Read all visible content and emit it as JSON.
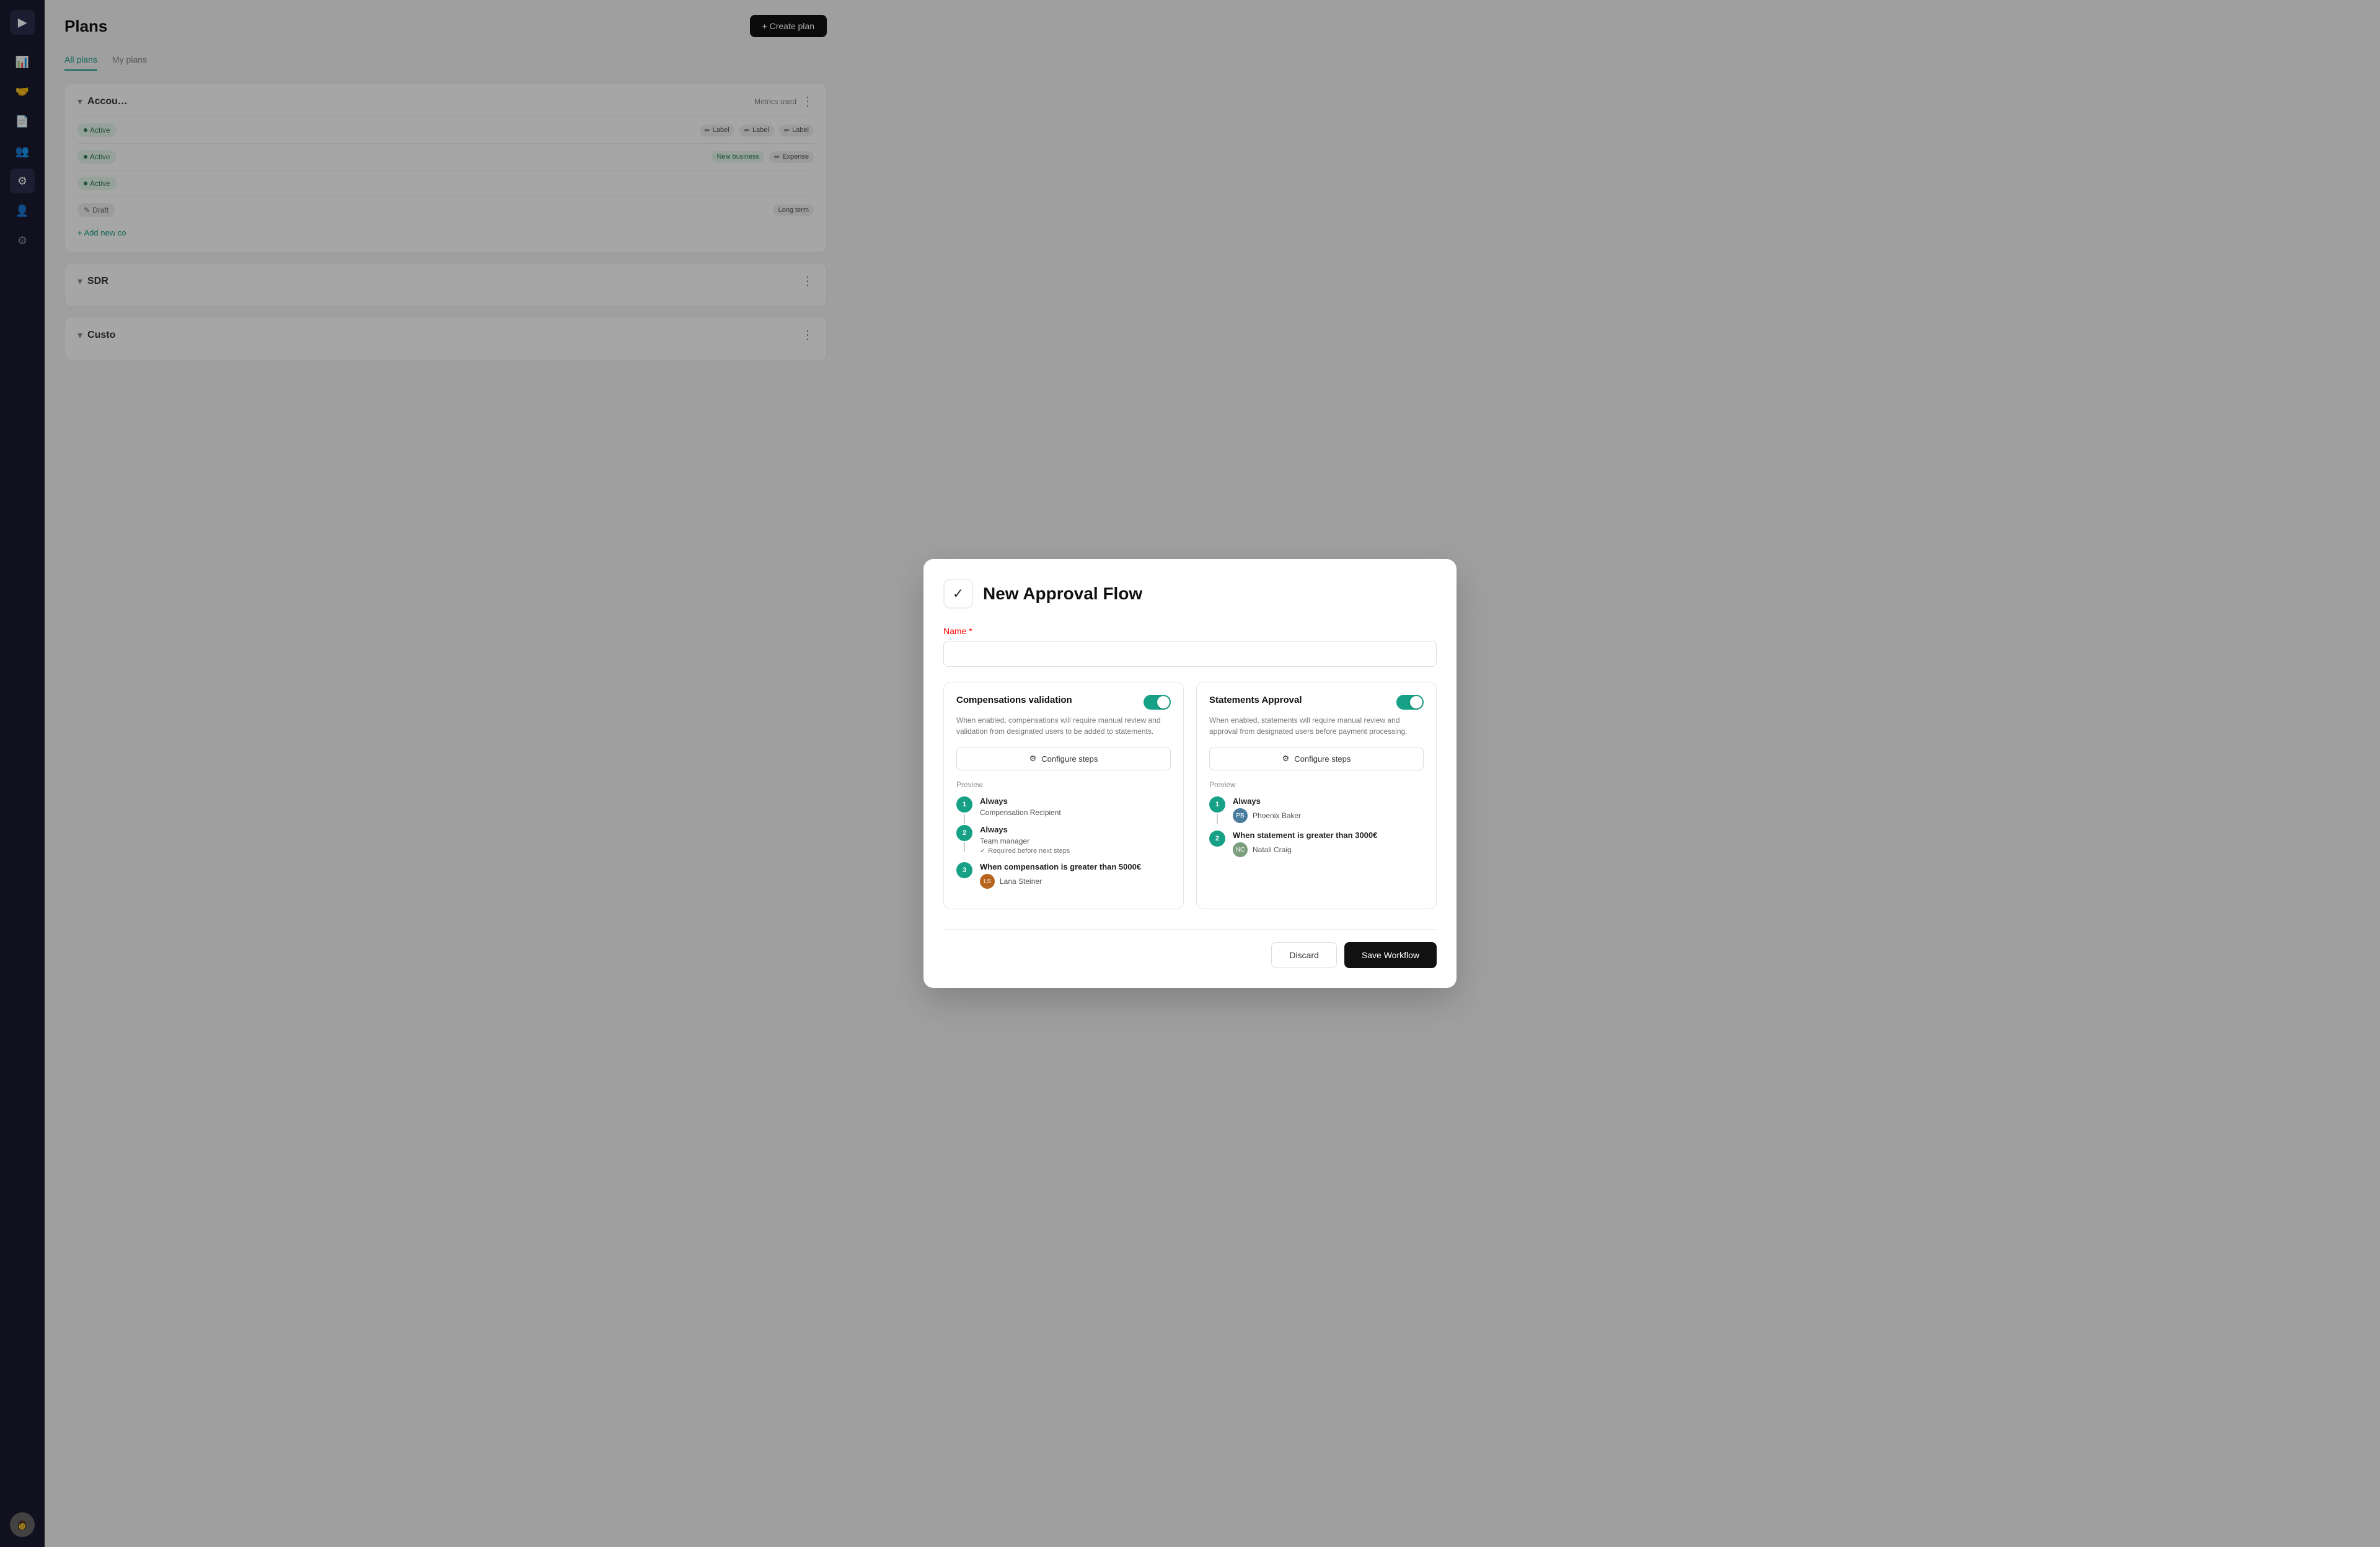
{
  "sidebar": {
    "logo": "▶",
    "icons": [
      {
        "name": "chart-icon",
        "symbol": "📊",
        "active": false
      },
      {
        "name": "commission-icon",
        "symbol": "🤝",
        "active": false
      },
      {
        "name": "document-icon",
        "symbol": "📄",
        "active": false
      },
      {
        "name": "team-icon",
        "symbol": "👥",
        "active": false
      },
      {
        "name": "workflow-icon",
        "symbol": "⚙",
        "active": true
      },
      {
        "name": "people-icon",
        "symbol": "👤",
        "active": false
      },
      {
        "name": "settings-icon",
        "symbol": "⚙",
        "active": false
      }
    ]
  },
  "page": {
    "title": "Plans",
    "create_button": "+ Create plan",
    "tabs": [
      {
        "label": "All plans",
        "active": true
      },
      {
        "label": "My plans",
        "active": false
      }
    ]
  },
  "sections": [
    {
      "name": "Account",
      "collapsed": false,
      "rows": [
        {
          "status": "Active",
          "type": "active",
          "metrics": [
            "Label",
            "Label",
            "Label"
          ]
        },
        {
          "status": "Active",
          "type": "active",
          "metrics": [
            "New business",
            "Expense"
          ]
        },
        {
          "status": "Active",
          "type": "active",
          "metrics": []
        },
        {
          "status": "Draft",
          "type": "draft",
          "metrics": [
            "Long term"
          ]
        }
      ],
      "metrics_header": "Metrics used",
      "add_label": "+ Add new co"
    },
    {
      "name": "SDR",
      "collapsed": false,
      "rows": [],
      "add_label": ""
    },
    {
      "name": "Custo",
      "collapsed": false,
      "rows": [],
      "add_label": ""
    }
  ],
  "modal": {
    "icon": "✓",
    "title": "New Approval Flow",
    "name_label": "Name",
    "name_required": true,
    "name_placeholder": "",
    "cards": [
      {
        "title": "Compensations validation",
        "description": "When enabled, compensations will require manual review and validation from designated users to be added to statements.",
        "enabled": true,
        "configure_label": "Configure steps",
        "preview_label": "Preview",
        "steps": [
          {
            "num": "1",
            "condition": "Always",
            "person": "Compensation Recipient",
            "has_avatar": false,
            "required": null
          },
          {
            "num": "2",
            "condition": "Always",
            "person": "Team manager",
            "has_avatar": false,
            "required": "Required before next steps"
          },
          {
            "num": "3",
            "condition": "When compensation is greater than 5000€",
            "person": "Lana Steiner",
            "has_avatar": true,
            "avatar_text": "LS",
            "avatar_color": "#b5651d",
            "required": null
          }
        ]
      },
      {
        "title": "Statements Approval",
        "description": "When enabled, statements will require manual review and approval from designated users before payment processing.",
        "enabled": true,
        "configure_label": "Configure steps",
        "preview_label": "Preview",
        "steps": [
          {
            "num": "1",
            "condition": "Always",
            "person": "Phoenix Baker",
            "has_avatar": true,
            "avatar_text": "PB",
            "avatar_color": "#4a7c9e",
            "required": null
          },
          {
            "num": "2",
            "condition": "When statement is greater than 3000€",
            "person": "Natali Craig",
            "has_avatar": true,
            "avatar_text": "NC",
            "avatar_color": "#7a9e7e",
            "required": null
          }
        ]
      }
    ],
    "footer": {
      "discard_label": "Discard",
      "save_label": "Save Workflow"
    }
  }
}
